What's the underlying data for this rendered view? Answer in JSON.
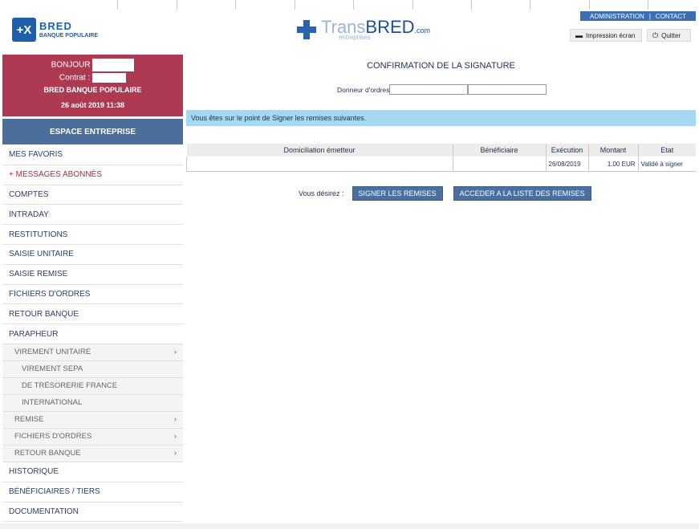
{
  "header": {
    "bred_logo_mark": "+X",
    "bred_name": "BRED",
    "bred_tagline": "BANQUE POPULAIRE",
    "trans_light": "Trans",
    "trans_bold": "BRED",
    "trans_com": ".com",
    "trans_sub": "entreprises",
    "links": {
      "admin": "ADMINISTRATION",
      "sep": "|",
      "contact": "CONTACT"
    },
    "print_label": "Impression écran",
    "quit_label": "Quitter"
  },
  "user": {
    "greeting": "BONJOUR",
    "contract_label": "Contrat :",
    "bank": "BRED BANQUE POPULAIRE",
    "datetime": "26 août 2019  11:38"
  },
  "sidebar": {
    "espace": "ESPACE ENTREPRISE",
    "items": [
      {
        "label": "MES FAVORIS"
      },
      {
        "label": "+ MESSAGES ABONNÉS"
      },
      {
        "label": "COMPTES"
      },
      {
        "label": "INTRADAY"
      },
      {
        "label": "RESTITUTIONS"
      },
      {
        "label": "SAISIE UNITAIRE"
      },
      {
        "label": "SAISIE REMISE"
      },
      {
        "label": "FICHIERS D'ORDRES"
      },
      {
        "label": "RETOUR BANQUE"
      },
      {
        "label": "PARAPHEUR"
      }
    ],
    "sub": {
      "virement_unitaire": "VIREMENT UNITAIRE",
      "virement_sepa": "VIREMENT SEPA",
      "tresorerie": "DE TRÉSORERIE FRANCE",
      "international": "INTERNATIONAL",
      "remise": "REMISE",
      "fichiers": "FICHIERS D'ORDRES",
      "retour": "RETOUR BANQUE",
      "chevron": "›"
    },
    "bottom_items": [
      {
        "label": "HISTORIQUE"
      },
      {
        "label": "BÉNÉFICIAIRES / TIERS"
      },
      {
        "label": "DOCUMENTATION"
      }
    ]
  },
  "main": {
    "title": "CONFIRMATION DE LA SIGNATURE",
    "donneur_label": "Donneur d'ordres",
    "info": "Vous êtes sur le point de Signer les remises suivantes.",
    "table": {
      "headers": [
        "Domiciliation émetteur",
        "Bénéficiaire",
        "Exécution",
        "Montant",
        "Etat"
      ],
      "row": {
        "domiciliation": "",
        "beneficiaire": "",
        "execution": "26/08/2019",
        "montant": "1.00  EUR",
        "etat": "Validé à signer"
      }
    },
    "actions_label": "Vous désirez :",
    "btn_sign": "SIGNER LES REMISES",
    "btn_list": "ACCEDER A LA LISTE DES REMISES"
  },
  "colors": {
    "user_box": "#ad3a52",
    "espace": "#4c6e9a",
    "info_bar": "#a5d8f2",
    "button": "#4a6fa1",
    "link_bar": "#3a6fb6"
  }
}
